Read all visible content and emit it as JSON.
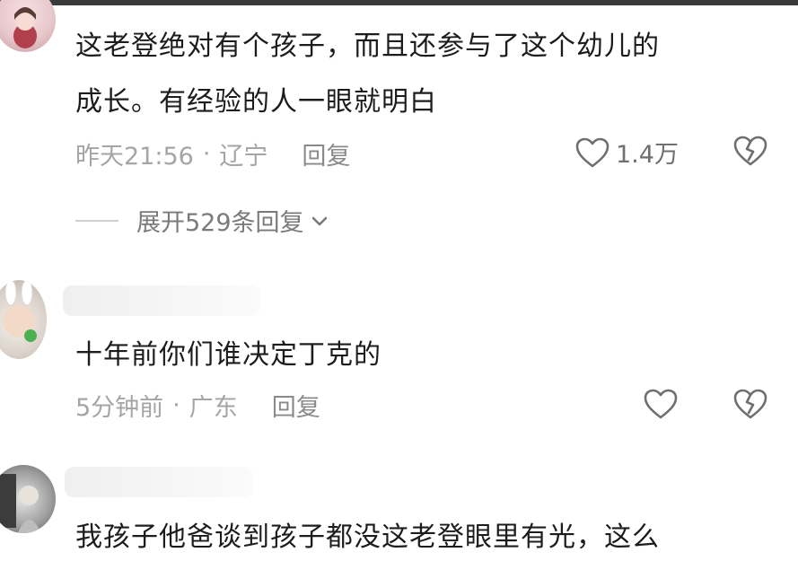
{
  "comments": [
    {
      "text_lines": [
        "这老登绝对有个孩子，而且还参与了这个幼儿的",
        "成长。有经验的人一眼就明白"
      ],
      "time": "昨天21:56",
      "location": "辽宁",
      "reply_label": "回复",
      "like_count": "1.4万",
      "expand_label": "展开529条回复"
    },
    {
      "text_lines": [
        "十年前你们谁决定丁克的"
      ],
      "time": "5分钟前",
      "location": "广东",
      "reply_label": "回复"
    },
    {
      "text_lines": [
        "我孩子他爸谈到孩子都没这老登眼里有光，这么"
      ]
    }
  ],
  "meta_separator": "·",
  "colors": {
    "meta": "#a5a5a5",
    "text": "#1c1c1c",
    "icon": "#6f6f6f",
    "top_border": "#3a3a3a"
  },
  "icons": {
    "like": "heart-outline-icon",
    "dislike": "broken-heart-icon",
    "expand": "chevron-down-icon"
  }
}
